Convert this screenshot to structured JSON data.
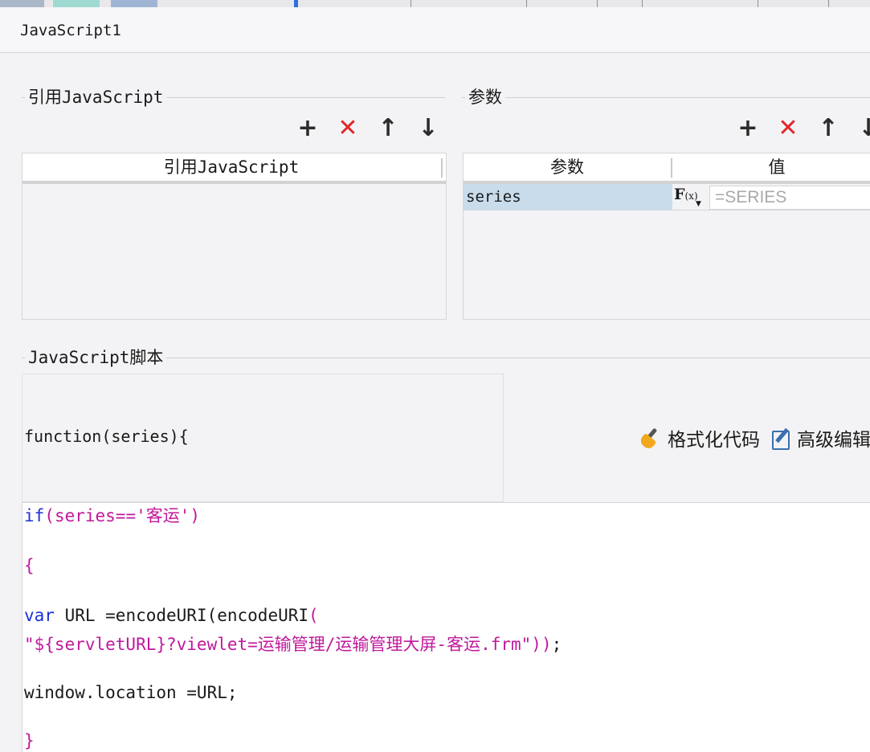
{
  "window": {
    "title": "JavaScript1"
  },
  "imports": {
    "legend": "引用JavaScript",
    "column_header": "引用JavaScript",
    "toolbar": {
      "add": "+",
      "delete": "✕",
      "up": "↑",
      "down": "↓"
    }
  },
  "params": {
    "legend": "参数",
    "columns": {
      "name": "参数",
      "value": "值"
    },
    "toolbar": {
      "add": "+",
      "delete": "✕",
      "up": "↑",
      "down": "↓"
    },
    "rows": [
      {
        "name": "series",
        "value_placeholder": "=SERIES"
      }
    ]
  },
  "script": {
    "legend": "JavaScript脚本",
    "signature": "function(series){",
    "actions": {
      "format": "格式化代码",
      "advanced": "高级编辑"
    },
    "code": {
      "line1_kw": "if",
      "line1_a": "(series==",
      "line1_str": "'客运'",
      "line1_b": ")",
      "line2": "{",
      "line3_kw": "var",
      "line3_a": " URL =encodeURI(encodeURI",
      "line3_b": "(",
      "line4_str": "\"${servletURL}?viewlet=运输管理/运输管理大屏-客运.frm\"",
      "line4_b": "))",
      "line4_c": ";",
      "line5": "window.location =URL;",
      "line6": "}"
    }
  },
  "colors": {
    "keyword": "#1c32d6",
    "string": "#c0189c",
    "delete": "#e3262a",
    "selected_row": "#c8dcec"
  }
}
